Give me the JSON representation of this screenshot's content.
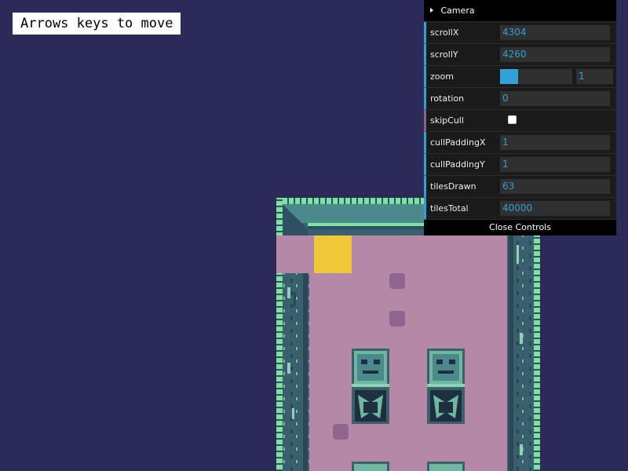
{
  "hint": {
    "text": "Arrows keys to move"
  },
  "gui": {
    "folder_title": "Camera",
    "rows": [
      {
        "label": "scrollX",
        "type": "number",
        "value": "4304"
      },
      {
        "label": "scrollY",
        "type": "number",
        "value": "4260"
      },
      {
        "label": "zoom",
        "type": "slider",
        "value": "1",
        "fill": 0.25
      },
      {
        "label": "rotation",
        "type": "number",
        "value": "0"
      },
      {
        "label": "skipCull",
        "type": "boolean",
        "checked": false
      },
      {
        "label": "cullPaddingX",
        "type": "number",
        "value": "1"
      },
      {
        "label": "cullPaddingY",
        "type": "number",
        "value": "1"
      },
      {
        "label": "tilesDrawn",
        "type": "number",
        "value": "63"
      },
      {
        "label": "tilesTotal",
        "type": "number",
        "value": "40000"
      }
    ],
    "close_label": "Close Controls"
  },
  "colors": {
    "background": "#2c2a57",
    "floor": "#b588a8",
    "wall": "#3a5f6e",
    "wall_edge": "#7fe3a0",
    "player": "#f0c93a",
    "accent": "#2fa1d6"
  }
}
